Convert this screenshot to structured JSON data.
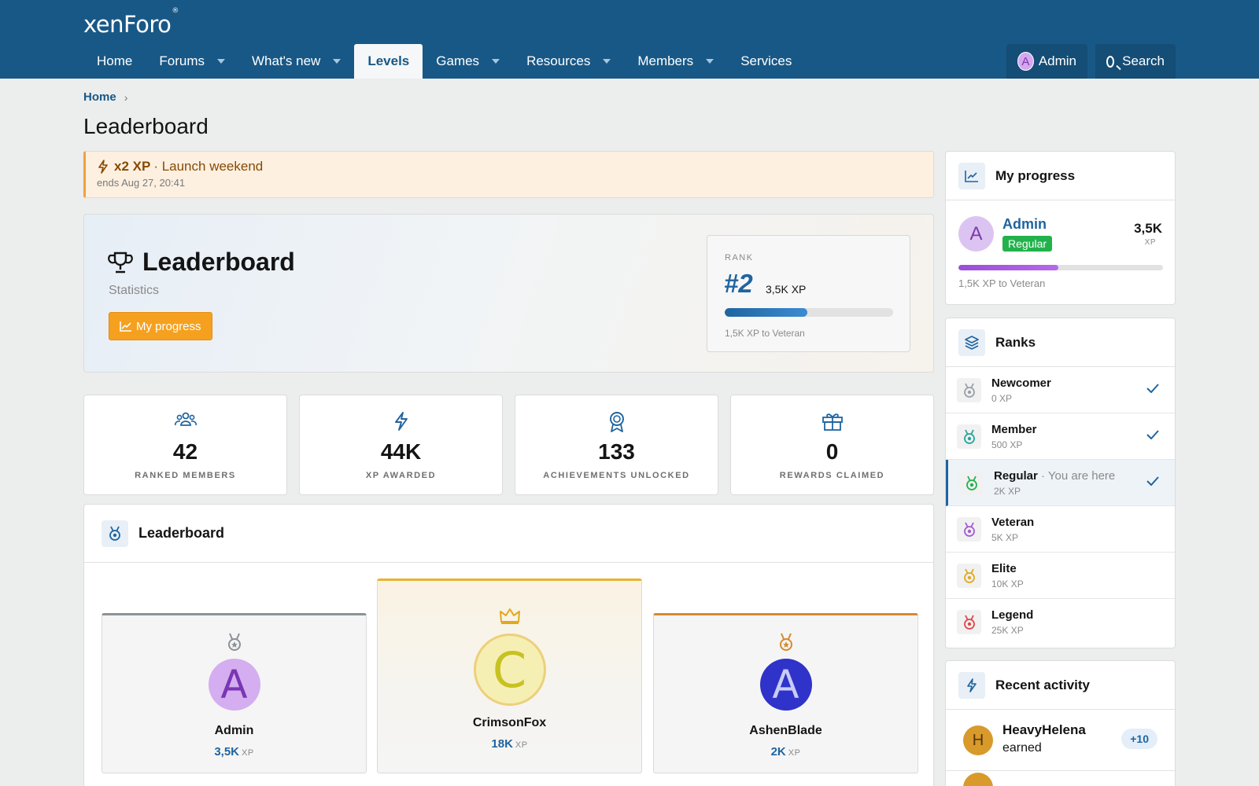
{
  "header": {
    "logo": "xenForo",
    "logo_mark": "®",
    "nav": [
      {
        "label": "Home",
        "dropdown": false,
        "active": false
      },
      {
        "label": "Forums",
        "dropdown": true,
        "active": false
      },
      {
        "label": "What's new",
        "dropdown": true,
        "active": false
      },
      {
        "label": "Levels",
        "dropdown": false,
        "active": true
      },
      {
        "label": "Games",
        "dropdown": true,
        "active": false
      },
      {
        "label": "Resources",
        "dropdown": true,
        "active": false
      },
      {
        "label": "Members",
        "dropdown": true,
        "active": false
      },
      {
        "label": "Services",
        "dropdown": false,
        "active": false
      }
    ],
    "account": {
      "initial": "A",
      "label": "Admin"
    },
    "search_label": "Search"
  },
  "breadcrumb": {
    "home": "Home",
    "separator": "›"
  },
  "page_title": "Leaderboard",
  "notice": {
    "highlight": "x2 XP",
    "text": "· Launch weekend",
    "ends": "ends Aug 27, 20:41",
    "icon": "bolt-icon"
  },
  "hero": {
    "title": "Leaderboard",
    "subtitle": "Statistics",
    "button_label": "My progress",
    "rank": {
      "label": "RANK",
      "number": "#2",
      "xp": "3,5K XP",
      "progress_fraction": 0.49,
      "to_next": "1,5K XP to Veteran"
    }
  },
  "stats": [
    {
      "value": "42",
      "label": "RANKED MEMBERS",
      "icon": "users-icon"
    },
    {
      "value": "44K",
      "label": "XP AWARDED",
      "icon": "bolt-icon"
    },
    {
      "value": "133",
      "label": "ACHIEVEMENTS UNLOCKED",
      "icon": "award-icon"
    },
    {
      "value": "0",
      "label": "REWARDS CLAIMED",
      "icon": "gift-icon"
    }
  ],
  "leaderboard": {
    "title": "Leaderboard",
    "podium": [
      {
        "place": 2,
        "initial": "A",
        "name": "Admin",
        "xp": "3,5K",
        "unit": "XP",
        "accent": "#8c9196",
        "avatar_bg": "#d4aef0",
        "avatar_fg": "#7a36b3"
      },
      {
        "place": 1,
        "initial": "C",
        "name": "CrimsonFox",
        "xp": "18K",
        "unit": "XP",
        "accent": "#e9b233",
        "avatar_bg": "#f6efb4",
        "avatar_fg": "#c7c221"
      },
      {
        "place": 3,
        "initial": "A",
        "name": "AshenBlade",
        "xp": "2K",
        "unit": "XP",
        "accent": "#d58a2e",
        "avatar_bg": "#2f33c9",
        "avatar_fg": "#c9ccf6"
      }
    ]
  },
  "sidebar": {
    "progress": {
      "title": "My progress",
      "initial": "A",
      "name": "Admin",
      "badge": "Regular",
      "xp": "3,5K",
      "unit": "XP",
      "progress_fraction": 0.49,
      "to_next": "1,5K XP to Veteran"
    },
    "ranks": {
      "title": "Ranks",
      "items": [
        {
          "name": "Newcomer",
          "xp": "0 XP",
          "color": "#9aa0a6",
          "achieved": true,
          "current": false,
          "here": ""
        },
        {
          "name": "Member",
          "xp": "500 XP",
          "color": "#26a69a",
          "achieved": true,
          "current": false,
          "here": ""
        },
        {
          "name": "Regular",
          "xp": "2K XP",
          "color": "#22b24c",
          "achieved": true,
          "current": true,
          "here": " · You are here"
        },
        {
          "name": "Veteran",
          "xp": "5K XP",
          "color": "#a35bd6",
          "achieved": false,
          "current": false,
          "here": ""
        },
        {
          "name": "Elite",
          "xp": "10K XP",
          "color": "#e3a81c",
          "achieved": false,
          "current": false,
          "here": ""
        },
        {
          "name": "Legend",
          "xp": "25K XP",
          "color": "#e0474c",
          "achieved": false,
          "current": false,
          "here": ""
        }
      ]
    },
    "activity": {
      "title": "Recent activity",
      "items": [
        {
          "initial": "H",
          "name": "HeavyHelena",
          "text": "earned",
          "badge": "+10"
        }
      ]
    }
  },
  "colors": {
    "header": "#185886",
    "accent": "#1f64a0",
    "button": "#f5a11f"
  }
}
